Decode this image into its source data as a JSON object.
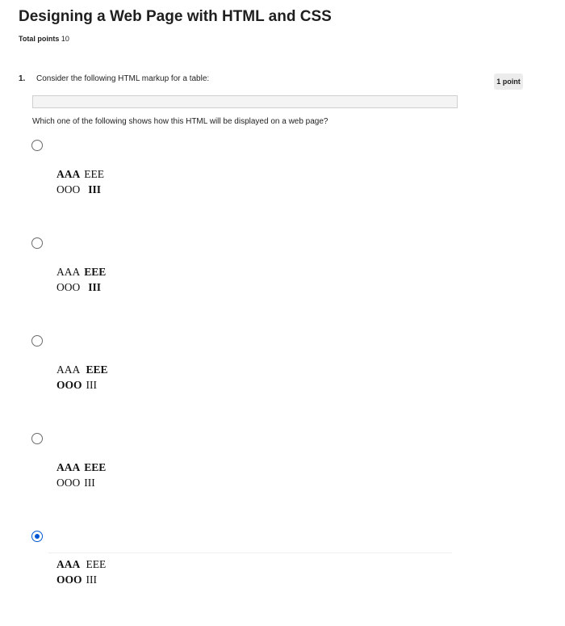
{
  "quiz": {
    "title": "Designing a Web Page with HTML and CSS",
    "total_points_label": "Total points",
    "total_points_value": "10"
  },
  "question": {
    "number": "1.",
    "prompt": "Consider the following HTML markup for a table:",
    "points_badge": "1 point",
    "code": "",
    "subprompt": "Which one of the following shows how this HTML will be displayed on a web page?",
    "options": [
      {
        "selected": false,
        "row1": [
          "AAA",
          "EEE"
        ],
        "row2": [
          "OOO",
          "III"
        ],
        "bold": [
          "row1.0",
          "row2.1"
        ]
      },
      {
        "selected": false,
        "row1": [
          "AAA",
          "EEE"
        ],
        "row2": [
          "OOO",
          "III"
        ],
        "bold": [
          "row1.1",
          "row2.1"
        ]
      },
      {
        "selected": false,
        "row1": [
          "AAA",
          "EEE"
        ],
        "row2": [
          "OOO",
          "III"
        ],
        "bold": [
          "row1.1",
          "row2.0"
        ]
      },
      {
        "selected": false,
        "row1": [
          "AAA",
          "EEE"
        ],
        "row2": [
          "OOO",
          "III"
        ],
        "bold": [
          "row1.0",
          "row1.1"
        ]
      },
      {
        "selected": true,
        "row1": [
          "AAA",
          "EEE"
        ],
        "row2": [
          "OOO",
          "III"
        ],
        "bold": [
          "row1.0",
          "row2.0"
        ]
      }
    ]
  },
  "colors": {
    "accent": "#0056d2",
    "badge_bg": "#ececec"
  }
}
